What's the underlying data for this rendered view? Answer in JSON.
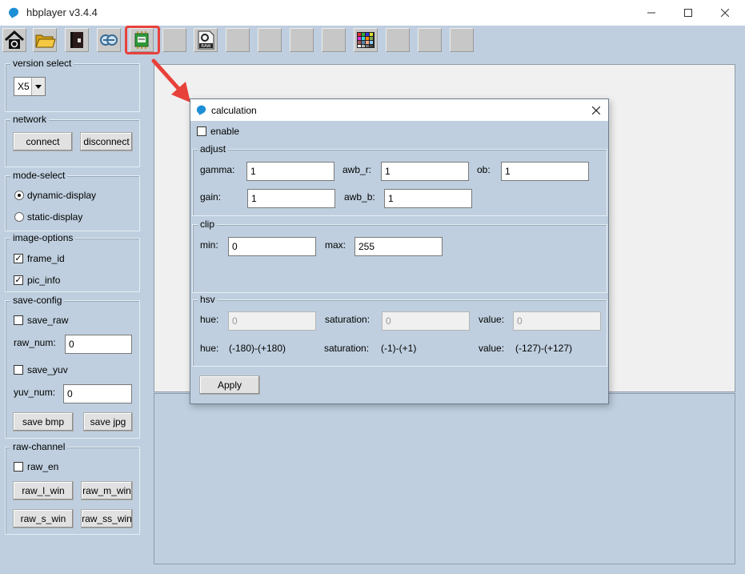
{
  "window": {
    "title": "hbplayer v3.4.4"
  },
  "toolbar": {
    "icons": [
      "home-icon",
      "folder-open-icon",
      "book-icon",
      "zoom-icon",
      "chip-icon",
      "blank",
      "raw-file-icon",
      "blank",
      "blank",
      "blank",
      "blank",
      "color-chart-icon",
      "blank",
      "blank",
      "blank"
    ]
  },
  "sidebar": {
    "version_select": {
      "title": "version select",
      "value": "X5"
    },
    "network": {
      "title": "network",
      "connect": "connect",
      "disconnect": "disconnect"
    },
    "mode_select": {
      "title": "mode-select",
      "dynamic": "dynamic-display",
      "static": "static-display"
    },
    "image_options": {
      "title": "image-options",
      "frame_id": "frame_id",
      "pic_info": "pic_info"
    },
    "save_config": {
      "title": "save-config",
      "save_raw": "save_raw",
      "raw_num_label": "raw_num:",
      "raw_num": "0",
      "save_yuv": "save_yuv",
      "yuv_num_label": "yuv_num:",
      "yuv_num": "0",
      "save_bmp": "save bmp",
      "save_jpg": "save jpg"
    },
    "raw_channel": {
      "title": "raw-channel",
      "raw_en": "raw_en",
      "raw_l_win": "raw_l_win",
      "raw_m_win": "raw_m_win",
      "raw_s_win": "raw_s_win",
      "raw_ss_win": "raw_ss_win"
    }
  },
  "dialog": {
    "title": "calculation",
    "enable": "enable",
    "adjust": {
      "title": "adjust",
      "gamma_label": "gamma:",
      "gamma": "1",
      "awb_r_label": "awb_r:",
      "awb_r": "1",
      "ob_label": "ob:",
      "ob": "1",
      "gain_label": "gain:",
      "gain": "1",
      "awb_b_label": "awb_b:",
      "awb_b": "1"
    },
    "clip": {
      "title": "clip",
      "min_label": "min:",
      "min": "0",
      "max_label": "max:",
      "max": "255"
    },
    "hsv": {
      "title": "hsv",
      "hue_label": "hue:",
      "hue": "0",
      "saturation_label": "saturation:",
      "saturation": "0",
      "value_label": "value:",
      "value": "0",
      "hue_range_label": "hue:",
      "hue_range": "(-180)-(+180)",
      "saturation_range_label": "saturation:",
      "saturation_range": "(-1)-(+1)",
      "value_range_label": "value:",
      "value_range": "(-127)-(+127)"
    },
    "apply": "Apply"
  },
  "colors": {
    "panel_bg": "#bfcfdf",
    "highlight": "#e8413b",
    "app_icon": "#1e8fd6"
  }
}
